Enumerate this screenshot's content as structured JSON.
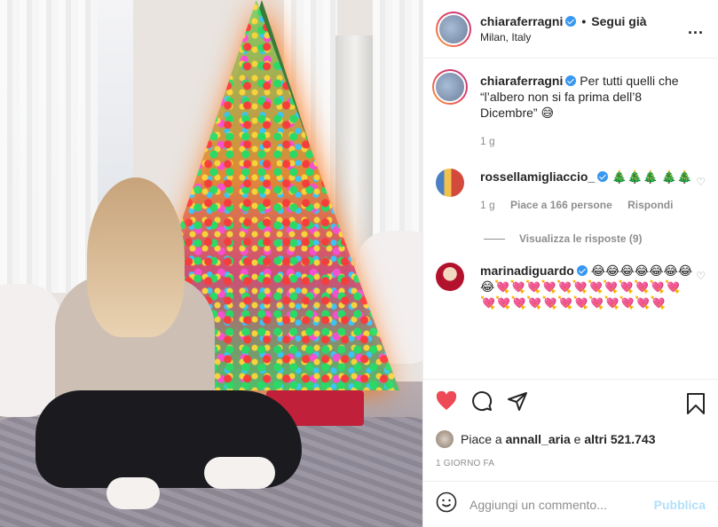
{
  "header": {
    "username": "chiaraferragni",
    "separator": "•",
    "follow_label": "Segui già",
    "location": "Milan, Italy",
    "more_label": "..."
  },
  "caption": {
    "username": "chiaraferragni",
    "text": "Per tutti quelli che “l’albero non si fa prima dell’8 Dicembre” 😅",
    "age": "1 g"
  },
  "comments": [
    {
      "username": "rossellamigliaccio_",
      "text": "🎄🎄🎄 🎄🎄",
      "age": "1 g",
      "likes": "Piace a 166 persone",
      "reply_label": "Rispondi",
      "view_replies": "Visualizza le risposte (9)"
    },
    {
      "username": "marinadiguardo",
      "text": "😂😂😂😂😂😂😂😂💘💘💘💘💘💘💘💘💘💘💘💘💘💘💘💘💘💘💘💘💘💘💘💘"
    }
  ],
  "likes": {
    "prefix": "Piace a",
    "user": "annall_aria",
    "connector": "e",
    "others": "altri 521.743"
  },
  "date": "1 GIORNO FA",
  "add_comment": {
    "placeholder": "Aggiungi un commento...",
    "publish_label": "Pubblica"
  },
  "colors": {
    "like_active": "#ed4956",
    "verified": "#3897f0",
    "publish_disabled": "#b2dffc",
    "secondary_text": "#8e8e8e"
  },
  "icons": [
    "heart-icon",
    "comment-icon",
    "share-icon",
    "bookmark-icon",
    "emoji-icon",
    "more-icon",
    "verified-icon"
  ]
}
